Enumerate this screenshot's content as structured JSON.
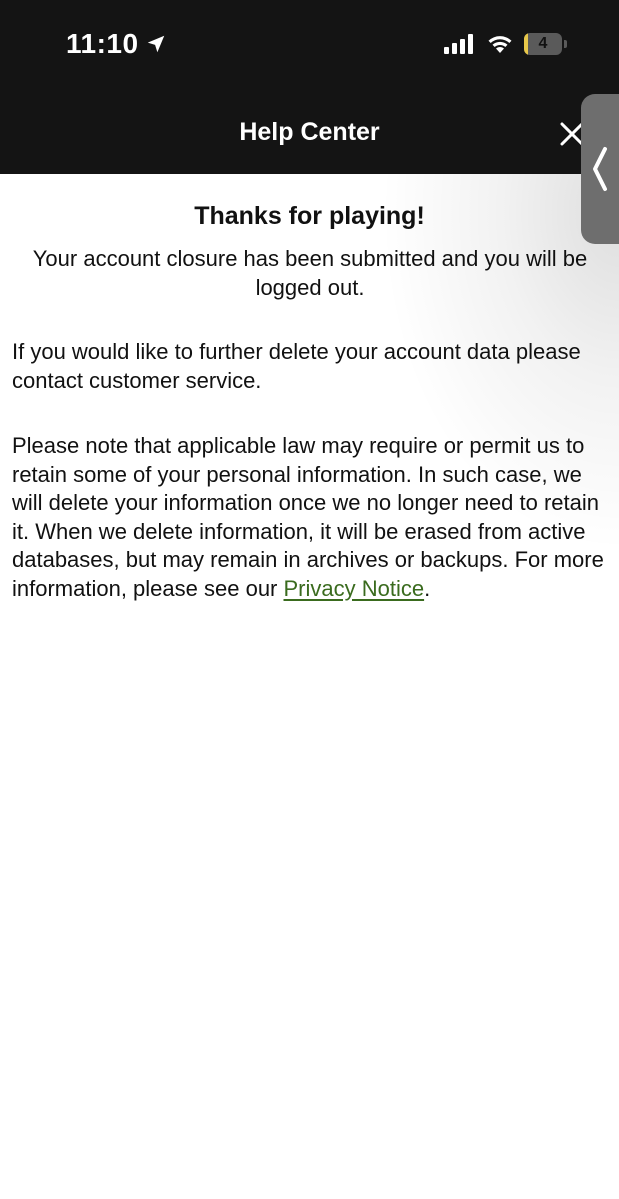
{
  "status_bar": {
    "time": "11:10",
    "battery_level": "4",
    "icons": [
      "location-arrow-icon",
      "signal-bars-icon",
      "wifi-icon",
      "battery-icon"
    ]
  },
  "header": {
    "title": "Help Center",
    "close_icon": "close-icon"
  },
  "side_handle": {
    "icon": "chevron-left-icon"
  },
  "content": {
    "title": "Thanks for playing!",
    "closure_message": "Your account closure has been submitted and you will be logged out.",
    "paragraph_1": "If you would like to further delete your account data please contact customer service.",
    "paragraph_2_text": "Please note that applicable law may require or permit us to retain some of your personal information. In such case, we will delete your information once we no longer need to retain it. When we delete information, it will be erased from active databases, but may remain in archives or backups. For more information, please see our ",
    "privacy_link": "Privacy Notice",
    "paragraph_2_end": "."
  },
  "colors": {
    "header_bg": "#141414",
    "link": "#3a6b1e",
    "text": "#111111"
  }
}
